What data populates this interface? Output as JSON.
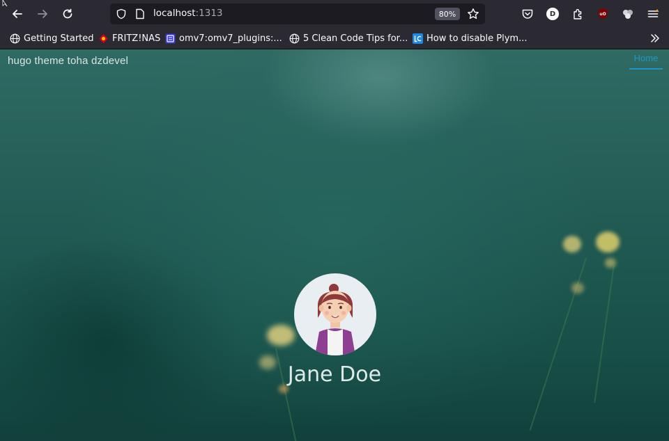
{
  "browser": {
    "url_host": "localhost",
    "url_port": ":1313",
    "zoom": "80%",
    "profile_initial": "D",
    "bookmarks": [
      {
        "label": "Getting Started",
        "icon": "globe-icon"
      },
      {
        "label": "FRITZ!NAS",
        "icon": "fritz-icon"
      },
      {
        "label": "omv7:omv7_plugins:...",
        "icon": "omv-icon"
      },
      {
        "label": "5 Clean Code Tips for...",
        "icon": "globe-icon"
      },
      {
        "label": "How to disable Plym...",
        "icon": "lc-icon"
      }
    ]
  },
  "site": {
    "title": "hugo theme toha dzdevel",
    "nav_home": "Home",
    "author_name": "Jane Doe"
  }
}
